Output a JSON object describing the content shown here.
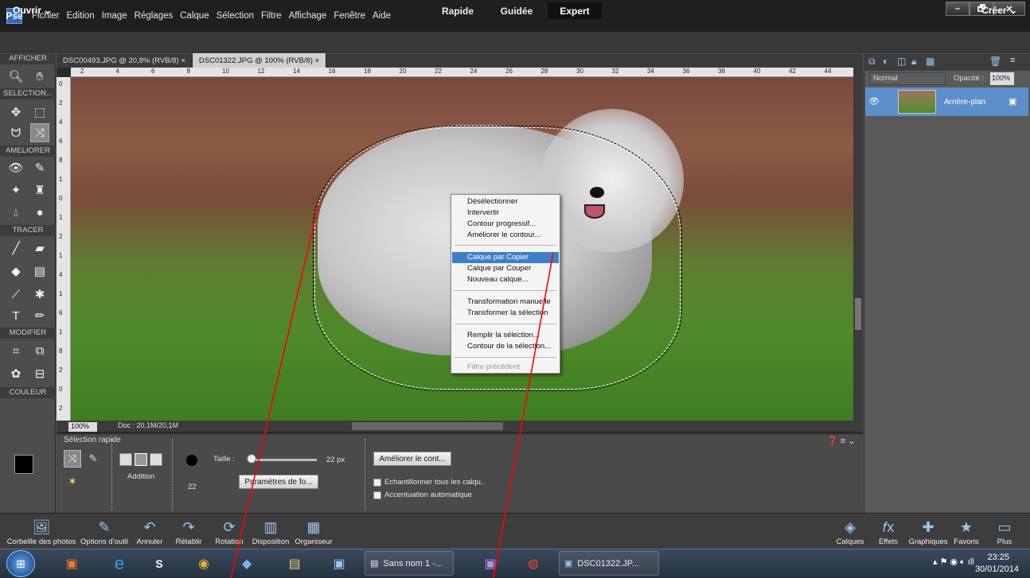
{
  "menubar": {
    "logo": "Pse",
    "items": [
      "Fichier",
      "Edition",
      "Image",
      "Réglages",
      "Calque",
      "Sélection",
      "Filtre",
      "Affichage",
      "Fenêtre",
      "Aide"
    ],
    "window_controls": [
      "–",
      "🗗",
      "✕"
    ]
  },
  "modebar": {
    "open_label": "Ouvrir  ⌄",
    "tabs": [
      "Rapide",
      "Guidée",
      "Expert"
    ],
    "active_tab": "Expert",
    "create_label": "Créer  ⌄"
  },
  "toolbox": {
    "sections": [
      "AFFICHER",
      "SELECTION...",
      "AMELIORER",
      "TRACER",
      "MODIFIER",
      "COULEUR"
    ]
  },
  "documents": {
    "tabs": [
      "DSC00493.JPG @ 20,8% (RVB/8)  ×",
      "DSC01322.JPG @ 100% (RVB/8)  ×"
    ],
    "active": 1
  },
  "ruler": {
    "top": [
      "2",
      "4",
      "6",
      "8",
      "10",
      "12",
      "14",
      "16",
      "18",
      "20",
      "22",
      "24",
      "26",
      "28",
      "30",
      "32",
      "34",
      "36",
      "38",
      "40",
      "42",
      "44"
    ],
    "left": [
      "0",
      "2",
      "4",
      "6",
      "8",
      "1",
      "0",
      "1",
      "2",
      "1",
      "4",
      "1",
      "6",
      "1",
      "8",
      "2",
      "0",
      "2"
    ]
  },
  "status": {
    "zoom": "100%",
    "doc": "Doc : 20,1M/20,1M"
  },
  "context_menu": {
    "items": [
      {
        "label": "Désélectionner",
        "state": "normal"
      },
      {
        "label": "Intervertir",
        "state": "normal"
      },
      {
        "label": "Contour progressif...",
        "state": "normal"
      },
      {
        "label": "Améliorer le contour...",
        "state": "normal"
      },
      {
        "label": "Calque par Copier",
        "state": "highlighted"
      },
      {
        "label": "Calque par Couper",
        "state": "normal"
      },
      {
        "label": "Nouveau calque...",
        "state": "normal"
      },
      {
        "label": "Transformation manuelle",
        "state": "normal"
      },
      {
        "label": "Transformer la sélection",
        "state": "normal"
      },
      {
        "label": "Remplir la sélection...",
        "state": "normal"
      },
      {
        "label": "Contour de la sélection...",
        "state": "normal"
      },
      {
        "label": "Filtre précédent",
        "state": "disabled"
      }
    ]
  },
  "options": {
    "title": "Sélection rapide",
    "mode_label": "Addition",
    "size_label": "Taille :",
    "size_value": "22 px",
    "brush_size": "22",
    "brush_params_button": "Paramètres de fo...",
    "refine_button": "Améliorer le cont...",
    "sample_all_label": "Echantillonner tous les calqu..",
    "auto_enhance_label": "Accentuation automatique"
  },
  "layers": {
    "blend_mode": "Normal",
    "opacity_label": "Opacité :",
    "opacity_value": "100%",
    "layer_name": "Arrière-plan"
  },
  "bottombar": {
    "items": [
      "Corbeille des photos",
      "Options d'outil",
      "Annuler",
      "Rétablir",
      "Rotation",
      "Disposition",
      "Organiseur",
      "Calques",
      "Effets",
      "Graphiques",
      "Favoris",
      "Plus"
    ]
  },
  "taskbar": {
    "window1": "Sans nom 1 -...",
    "window2": "DSC01322.JP...",
    "time": "23:25",
    "date": "30/01/2014"
  },
  "colors": {
    "accent": "#3f7fc7",
    "annotation_arrow": "#ff0000"
  }
}
